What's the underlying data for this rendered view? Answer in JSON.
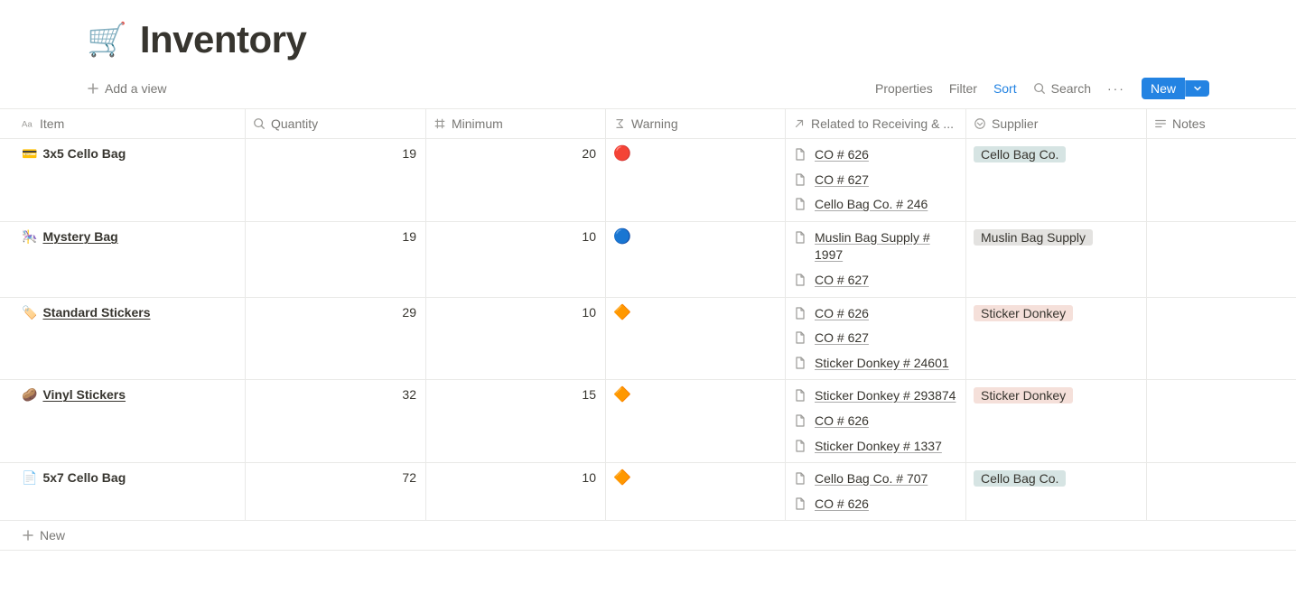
{
  "title": {
    "emoji": "🛒",
    "text": "Inventory"
  },
  "toolbar": {
    "add_view": "Add a view",
    "properties": "Properties",
    "filter": "Filter",
    "sort": "Sort",
    "search": "Search",
    "new": "New",
    "new_row": "New"
  },
  "columns": {
    "item": "Item",
    "quantity": "Quantity",
    "minimum": "Minimum",
    "warning": "Warning",
    "related": "Related to Receiving & ...",
    "supplier": "Supplier",
    "notes": "Notes"
  },
  "supplier_styles": {
    "Cello Bag Co.": "cello",
    "Muslin Bag Supply": "muslin",
    "Sticker Donkey": "sticker"
  },
  "rows": [
    {
      "emoji": "💳",
      "underline": false,
      "name": "3x5 Cello Bag",
      "quantity": 19,
      "minimum": 20,
      "warning": "🔴",
      "related": [
        "CO # 626",
        "CO # 627",
        "Cello Bag Co. # 246"
      ],
      "supplier": "Cello Bag Co.",
      "notes": ""
    },
    {
      "emoji": "🎠",
      "underline": true,
      "name": "Mystery Bag",
      "quantity": 19,
      "minimum": 10,
      "warning": "🔵",
      "related": [
        "Muslin Bag Supply # 1997",
        "CO # 627"
      ],
      "supplier": "Muslin Bag Supply",
      "notes": ""
    },
    {
      "emoji": "🏷️",
      "underline": true,
      "name": "Standard Stickers",
      "quantity": 29,
      "minimum": 10,
      "warning": "🔶",
      "related": [
        "CO # 626",
        "CO # 627",
        "Sticker Donkey # 24601"
      ],
      "supplier": "Sticker Donkey",
      "notes": ""
    },
    {
      "emoji": "🥔",
      "underline": true,
      "name": "Vinyl Stickers",
      "quantity": 32,
      "minimum": 15,
      "warning": "🔶",
      "related": [
        "Sticker Donkey # 293874",
        "CO # 626",
        "Sticker Donkey # 1337"
      ],
      "supplier": "Sticker Donkey",
      "notes": ""
    },
    {
      "emoji": "📄",
      "underline": false,
      "name": "5x7 Cello Bag",
      "quantity": 72,
      "minimum": 10,
      "warning": "🔶",
      "related": [
        "Cello Bag Co. # 707",
        "CO # 626"
      ],
      "supplier": "Cello Bag Co.",
      "notes": ""
    }
  ]
}
